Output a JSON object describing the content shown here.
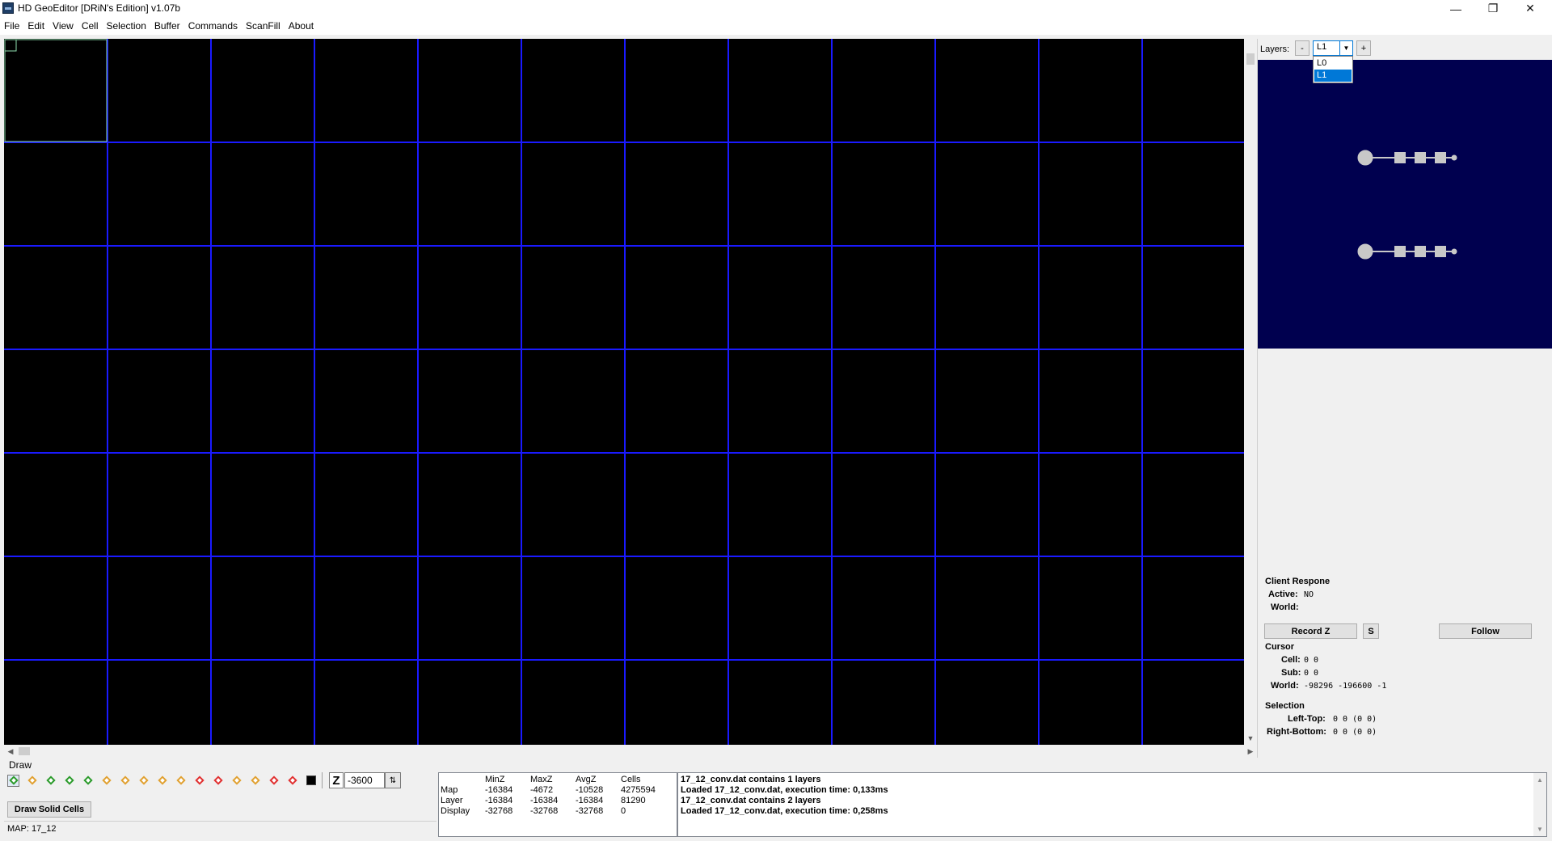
{
  "window": {
    "title": "HD GeoEditor [DRiN's Edition] v1.07b",
    "min_glyph": "—",
    "max_glyph": "❐",
    "close_glyph": "✕"
  },
  "menu": [
    {
      "label": "File"
    },
    {
      "label": "Edit"
    },
    {
      "label": "View"
    },
    {
      "label": "Cell"
    },
    {
      "label": "Selection"
    },
    {
      "label": "Buffer"
    },
    {
      "label": "Commands"
    },
    {
      "label": "ScanFill"
    },
    {
      "label": "About"
    }
  ],
  "map": {
    "background": "#000000",
    "grid_color": "#1a1aff",
    "highlight_color": "#90e0b0"
  },
  "layers": {
    "label": "Layers:",
    "minus": "-",
    "plus": "+",
    "selected": "L1",
    "options": [
      "L0",
      "L1"
    ]
  },
  "client": {
    "title": "Client Respone",
    "active_label": "Active:",
    "active_value": "NO",
    "world_label": "World:",
    "world_value": ""
  },
  "buttons": {
    "record_z": "Record Z",
    "s": "S",
    "follow": "Follow",
    "draw_solid": "Draw Solid Cells"
  },
  "cursor": {
    "title": "Cursor",
    "cell_label": "Cell:",
    "cell_value": "0 0",
    "sub_label": "Sub:",
    "sub_value": "0 0",
    "world_label": "World:",
    "world_value": "-98296 -196600 -1"
  },
  "selection": {
    "title": "Selection",
    "lt_label": "Left-Top:",
    "lt_value": "0 0 (0 0)",
    "rb_label": "Right-Bottom:",
    "rb_value": "0 0 (0 0)"
  },
  "draw": {
    "label": "Draw",
    "z_label": "Z",
    "z_value": "-3600",
    "spin_glyph": "⇅"
  },
  "status": {
    "map_label": "MAP: 17_12"
  },
  "stats": {
    "columns": [
      "MinZ",
      "MaxZ",
      "AvgZ",
      "Cells"
    ],
    "rows": [
      {
        "name": "Map",
        "values": [
          "-16384",
          "-4672",
          "-10528",
          "4275594"
        ]
      },
      {
        "name": "Layer",
        "values": [
          "-16384",
          "-16384",
          "-16384",
          "81290"
        ]
      },
      {
        "name": "Display",
        "values": [
          "-32768",
          "-32768",
          "-32768",
          "0"
        ]
      }
    ]
  },
  "log": [
    "17_12_conv.dat contains 1 layers",
    "Loaded 17_12_conv.dat, execution time: 0,133ms",
    "17_12_conv.dat contains 2 layers",
    "Loaded 17_12_conv.dat, execution time: 0,258ms"
  ]
}
